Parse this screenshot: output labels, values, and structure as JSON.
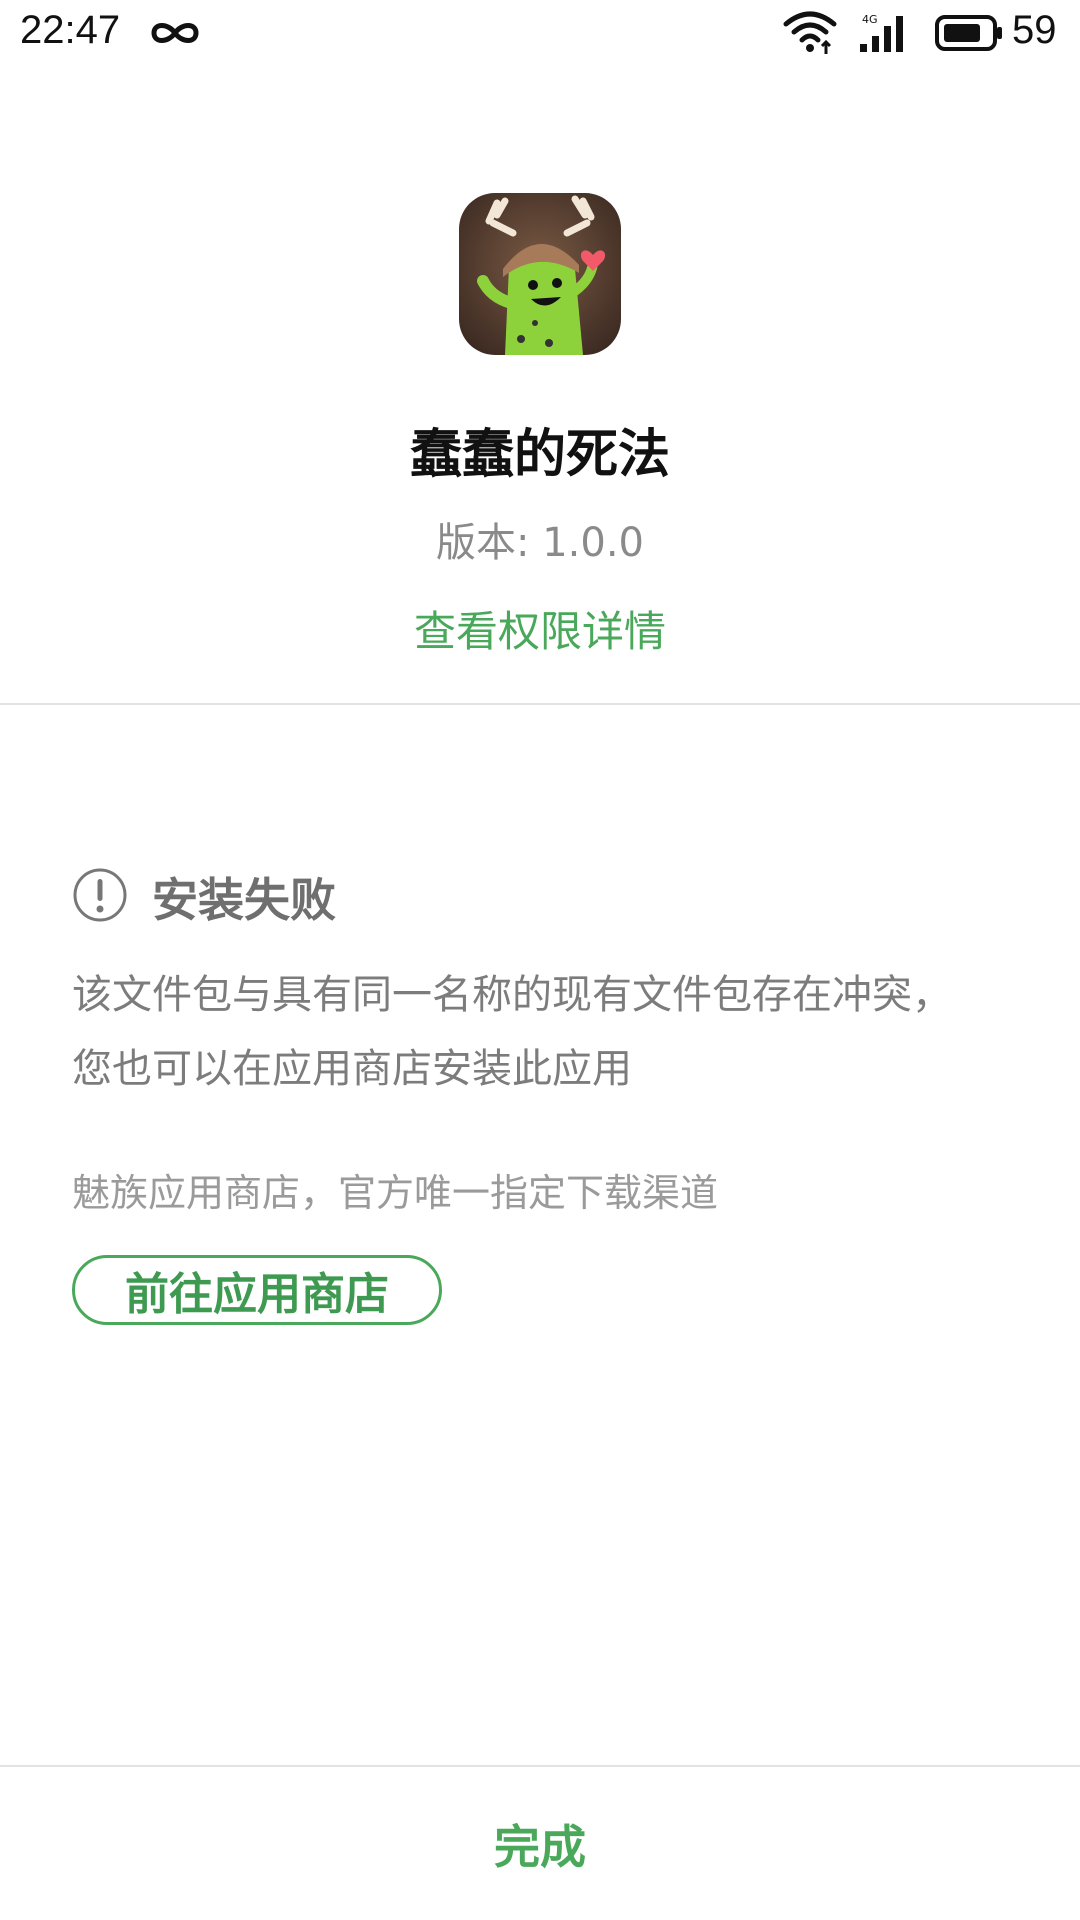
{
  "status_bar": {
    "time": "22:47",
    "battery_level": "59",
    "network_type": "4G",
    "icons": [
      "infinity-icon",
      "wifi-icon",
      "cellular-signal-icon",
      "battery-icon"
    ]
  },
  "app": {
    "name": "蠢蠢的死法",
    "version": "版本: 1.0.0",
    "icon": "app-icon-green-character-with-antlers",
    "permission_link": "查看权限详情"
  },
  "failure": {
    "icon": "warning-icon",
    "title": "安装失败",
    "message_lines": [
      "该文件包与具有同一名称的现有文件包存在冲突，",
      "您也可以在应用商店安装此应用"
    ],
    "store_note": "魅族应用商店，官方唯一指定下载渠道",
    "store_button": "前往应用商店"
  },
  "footer": {
    "done_label": "完成"
  },
  "colors": {
    "accent": "#4aa85a",
    "text_primary": "#111111",
    "text_secondary": "#7c7c7c",
    "divider": "#e3e3e3"
  }
}
